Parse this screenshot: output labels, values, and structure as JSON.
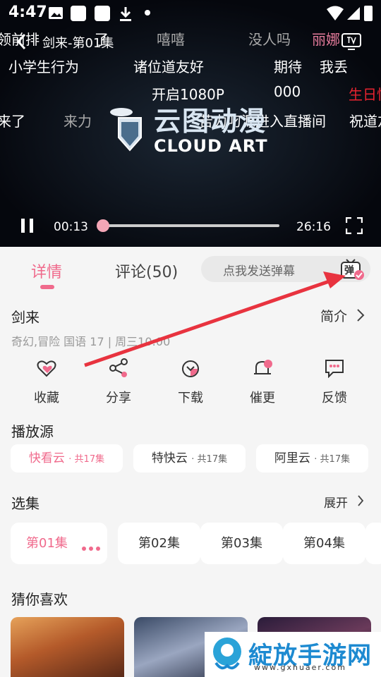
{
  "status_bar": {
    "time": "4:47"
  },
  "header": {
    "title": "剑来-第01集"
  },
  "danmaku": [
    {
      "text": "领前排",
      "cls": "dim"
    },
    {
      "text": "了",
      "cls": "dim"
    },
    {
      "text": "嘻嘻",
      "cls": "dim"
    },
    {
      "text": "没人吗",
      "cls": "dim"
    },
    {
      "text": "丽娜",
      "cls": "pinkish"
    },
    {
      "text": "小学生行为",
      "cls": ""
    },
    {
      "text": "诸位道友好",
      "cls": ""
    },
    {
      "text": "期待",
      "cls": ""
    },
    {
      "text": "我丢",
      "cls": ""
    },
    {
      "text": "开启1080P",
      "cls": ""
    },
    {
      "text": "000",
      "cls": ""
    },
    {
      "text": "生日快",
      "cls": "red"
    },
    {
      "text": "来了",
      "cls": ""
    },
    {
      "text": "来力",
      "cls": "dim"
    },
    {
      "text": "苦力叼源进入直播间",
      "cls": ""
    },
    {
      "text": "祝道友",
      "cls": ""
    }
  ],
  "logo": {
    "text": "CLOUD ART",
    "chinese": "云图动漫"
  },
  "player": {
    "current_time": "00:13",
    "duration": "26:16",
    "progress": 0.008
  },
  "tabs": {
    "details": "详情",
    "comments": "评论(50)"
  },
  "danmu_input": {
    "placeholder": "点我发送弹幕",
    "icon_text": "弹"
  },
  "show": {
    "title": "剑来",
    "intro_label": "简介",
    "meta": "奇幻,冒险 国语 17 | 周三10:00"
  },
  "actions": [
    {
      "label": "收藏",
      "icon": "heart-icon"
    },
    {
      "label": "分享",
      "icon": "share-icon"
    },
    {
      "label": "下载",
      "icon": "download-icon"
    },
    {
      "label": "催更",
      "icon": "bell-icon"
    },
    {
      "label": "反馈",
      "icon": "feedback-icon"
    }
  ],
  "sources_section": {
    "title": "播放源",
    "items": [
      {
        "name": "快看云",
        "count": "· 共17集"
      },
      {
        "name": "特快云",
        "count": "· 共17集"
      },
      {
        "name": "阿里云",
        "count": "· 共17集"
      }
    ]
  },
  "episodes_section": {
    "title": "选集",
    "expand_label": "展开",
    "items": [
      "第01集",
      "第02集",
      "第03集",
      "第04集"
    ]
  },
  "recommend_section": {
    "title": "猜你喜欢"
  },
  "watermark": {
    "text": "綻放手游网",
    "url": "www.gxhuaer.com"
  },
  "colors": {
    "accent": "#f06a8c",
    "annotation_arrow": "#e8333f",
    "player_bg": "#05070d"
  }
}
